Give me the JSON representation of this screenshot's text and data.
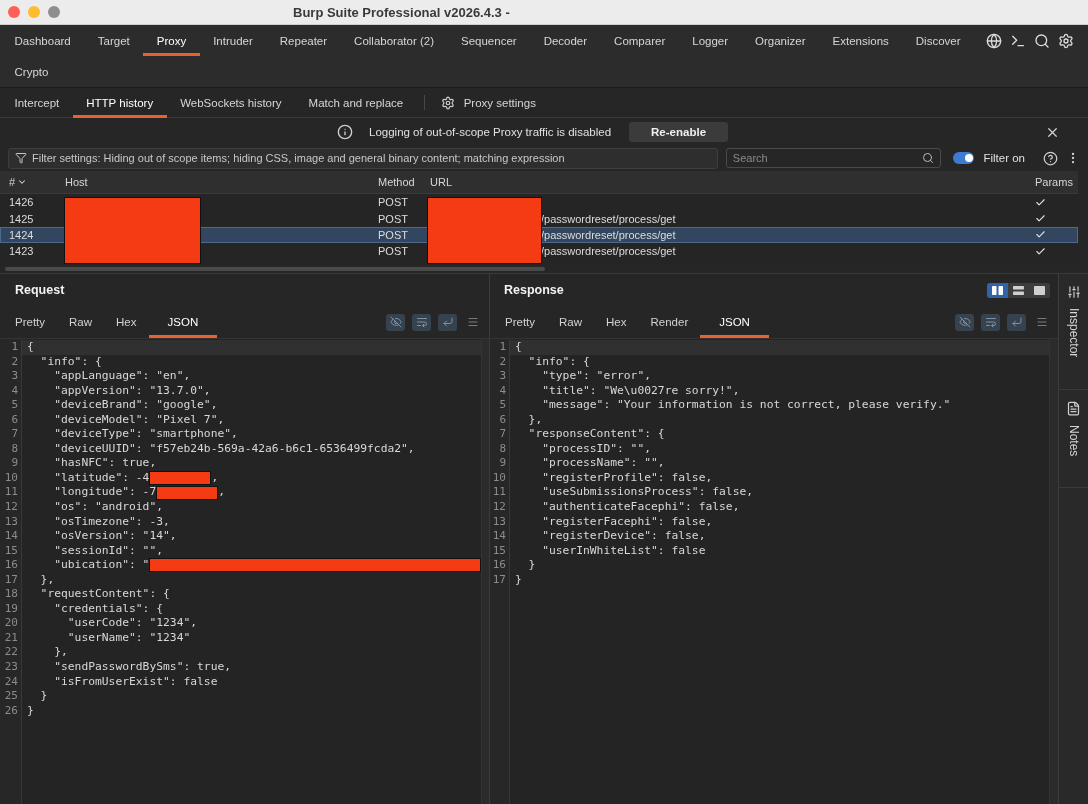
{
  "window": {
    "title": "Burp Suite Professional v2026.4.3 -"
  },
  "main_tabs": [
    {
      "label": "Dashboard",
      "selected": false
    },
    {
      "label": "Target",
      "selected": false
    },
    {
      "label": "Proxy",
      "selected": true
    },
    {
      "label": "Intruder",
      "selected": false
    },
    {
      "label": "Repeater",
      "selected": false
    },
    {
      "label": "Collaborator (2)",
      "selected": false
    },
    {
      "label": "Sequencer",
      "selected": false
    },
    {
      "label": "Decoder",
      "selected": false
    },
    {
      "label": "Comparer",
      "selected": false
    },
    {
      "label": "Logger",
      "selected": false
    },
    {
      "label": "Organizer",
      "selected": false
    },
    {
      "label": "Extensions",
      "selected": false
    },
    {
      "label": "Discover",
      "selected": false
    },
    {
      "label": "Crypto",
      "selected": false
    }
  ],
  "proxy_tabs": [
    {
      "label": "Intercept",
      "selected": false
    },
    {
      "label": "HTTP history",
      "selected": true
    },
    {
      "label": "WebSockets history",
      "selected": false
    },
    {
      "label": "Match and replace",
      "selected": false
    }
  ],
  "proxy_settings_button": "Proxy settings",
  "notice": {
    "message": "Logging of out-of-scope Proxy traffic is disabled",
    "action": "Re-enable"
  },
  "filter_bar": {
    "summary": "Filter settings: Hiding out of scope items; hiding CSS, image and general binary content; matching expression",
    "search": {
      "placeholder": "Search"
    },
    "filter_toggle": {
      "label": "Filter on",
      "on": true
    }
  },
  "history_table": {
    "redacted": true,
    "columns": [
      {
        "label": "#",
        "sorted": true
      },
      {
        "label": "Host",
        "sorted": false
      },
      {
        "label": "Method",
        "sorted": false
      },
      {
        "label": "URL",
        "sorted": false
      },
      {
        "label": "Params",
        "sorted": false
      }
    ],
    "rows": [
      {
        "number": "1426",
        "method": "POST",
        "params": true,
        "selected": false
      },
      {
        "number": "1425",
        "method": "POST",
        "url": "/passwordreset/process/get",
        "params": true,
        "selected": false
      },
      {
        "number": "1424",
        "method": "POST",
        "url": "/passwordreset/process/get",
        "params": true,
        "selected": true
      },
      {
        "number": "1423",
        "method": "POST",
        "url": "/passwordreset/process/get",
        "params": true,
        "selected": false
      }
    ]
  },
  "request": {
    "title": "Request",
    "tabs": [
      {
        "label": "Pretty",
        "selected": false
      },
      {
        "label": "Raw",
        "selected": false
      },
      {
        "label": "Hex",
        "selected": false
      },
      {
        "label": "JSON",
        "selected": true
      }
    ],
    "lines": [
      {
        "n": "1",
        "text": "{",
        "current": true
      },
      {
        "n": "2",
        "text": "  \"info\": {",
        "current": false
      },
      {
        "n": "3",
        "text": "    \"appLanguage\": \"en\",",
        "current": false
      },
      {
        "n": "4",
        "text": "    \"appVersion\": \"13.7.0\",",
        "current": false
      },
      {
        "n": "5",
        "text": "    \"deviceBrand\": \"google\",",
        "current": false
      },
      {
        "n": "6",
        "text": "    \"deviceModel\": \"Pixel 7\",",
        "current": false
      },
      {
        "n": "7",
        "text": "    \"deviceType\": \"smartphone\",",
        "current": false
      },
      {
        "n": "8",
        "text": "    \"deviceUUID\": \"f57eb24b-569a-42a6-b6c1-6536499fcda2\",",
        "current": false
      },
      {
        "n": "9",
        "text": "    \"hasNFC\": true,",
        "current": false
      },
      {
        "n": "10",
        "current": false,
        "parts": [
          {
            "kind": "code",
            "text": "    \"latitude\": -4"
          },
          {
            "kind": "redacted"
          },
          {
            "kind": "code",
            "text": ","
          }
        ]
      },
      {
        "n": "11",
        "current": false,
        "parts": [
          {
            "kind": "code",
            "text": "    \"longitude\": -7"
          },
          {
            "kind": "redacted"
          },
          {
            "kind": "code",
            "text": ","
          }
        ]
      },
      {
        "n": "12",
        "text": "    \"os\": \"android\",",
        "current": false
      },
      {
        "n": "13",
        "text": "    \"osTimezone\": -3,",
        "current": false
      },
      {
        "n": "14",
        "text": "    \"osVersion\": \"14\",",
        "current": false
      },
      {
        "n": "15",
        "text": "    \"sessionId\": \"\",",
        "current": false
      },
      {
        "n": "16",
        "current": false,
        "parts": [
          {
            "kind": "code",
            "text": "    \"ubication\": \""
          },
          {
            "kind": "redacted_to_end"
          }
        ]
      },
      {
        "n": "17",
        "text": "  },",
        "current": false
      },
      {
        "n": "18",
        "text": "  \"requestContent\": {",
        "current": false
      },
      {
        "n": "19",
        "text": "    \"credentials\": {",
        "current": false
      },
      {
        "n": "20",
        "text": "      \"userCode\": \"1234\",",
        "current": false
      },
      {
        "n": "21",
        "text": "      \"userName\": \"1234\"",
        "current": false
      },
      {
        "n": "22",
        "text": "    },",
        "current": false
      },
      {
        "n": "23",
        "text": "    \"sendPasswordBySms\": true,",
        "current": false
      },
      {
        "n": "24",
        "text": "    \"isFromUserExist\": false",
        "current": false
      },
      {
        "n": "25",
        "text": "  }",
        "current": false
      },
      {
        "n": "26",
        "text": "}",
        "current": false
      }
    ]
  },
  "response": {
    "title": "Response",
    "view_modes": [
      {
        "kind": "columns",
        "selected": true
      },
      {
        "kind": "rows",
        "selected": false
      },
      {
        "kind": "single",
        "selected": false
      }
    ],
    "tabs": [
      {
        "label": "Pretty",
        "selected": false
      },
      {
        "label": "Raw",
        "selected": false
      },
      {
        "label": "Hex",
        "selected": false
      },
      {
        "label": "Render",
        "selected": false
      },
      {
        "label": "JSON",
        "selected": true
      }
    ],
    "lines": [
      {
        "n": "1",
        "text": "{",
        "current": true
      },
      {
        "n": "2",
        "text": "  \"info\": {",
        "current": false
      },
      {
        "n": "3",
        "text": "    \"type\": \"error\",",
        "current": false
      },
      {
        "n": "4",
        "text": "    \"title\": \"We\\u0027re sorry!\",",
        "current": false
      },
      {
        "n": "5",
        "text": "    \"message\": \"Your information is not correct, please verify.\"",
        "current": false
      },
      {
        "n": "6",
        "text": "  },",
        "current": false
      },
      {
        "n": "7",
        "text": "  \"responseContent\": {",
        "current": false
      },
      {
        "n": "8",
        "text": "    \"processID\": \"\",",
        "current": false
      },
      {
        "n": "9",
        "text": "    \"processName\": \"\",",
        "current": false
      },
      {
        "n": "10",
        "text": "    \"registerProfile\": false,",
        "current": false
      },
      {
        "n": "11",
        "text": "    \"useSubmissionsProcess\": false,",
        "current": false
      },
      {
        "n": "12",
        "text": "    \"authenticateFacephi\": false,",
        "current": false
      },
      {
        "n": "13",
        "text": "    \"registerFacephi\": false,",
        "current": false
      },
      {
        "n": "14",
        "text": "    \"registerDevice\": false,",
        "current": false
      },
      {
        "n": "15",
        "text": "    \"userInWhiteList\": false",
        "current": false
      },
      {
        "n": "16",
        "text": "  }",
        "current": false
      },
      {
        "n": "17",
        "text": "}",
        "current": false
      }
    ]
  },
  "side_panel": [
    {
      "kind": "inspector",
      "label": "Inspector"
    },
    {
      "kind": "notes",
      "label": "Notes"
    }
  ]
}
